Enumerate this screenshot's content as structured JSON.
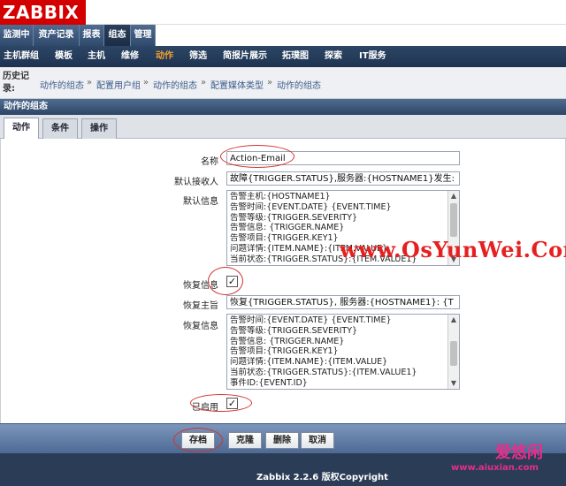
{
  "logo": "ZABBIX",
  "main_menu": [
    "监测中",
    "资产记录",
    "报表",
    "组态",
    "管理"
  ],
  "sub_menu": [
    "主机群组",
    "模板",
    "主机",
    "维修",
    "动作",
    "筛选",
    "简报片展示",
    "拓璞图",
    "探索",
    "IT服务"
  ],
  "history": {
    "label": "历史记录:",
    "crumbs": [
      "动作的组态",
      "配置用户组",
      "动作的组态",
      "配置媒体类型",
      "动作的组态"
    ],
    "sep": "»"
  },
  "section_title": "动作的组态",
  "tabs": [
    "动作",
    "条件",
    "操作"
  ],
  "form": {
    "name_label": "名称",
    "name_value": "Action-Email",
    "default_recipient_label": "默认接收人",
    "default_recipient_value": "故障{TRIGGER.STATUS},服务器:{HOSTNAME1}发生:",
    "default_message_label": "默认信息",
    "default_message_lines": [
      "告警主机:{HOSTNAME1}",
      "告警时间:{EVENT.DATE}  {EVENT.TIME}",
      "告警等级:{TRIGGER.SEVERITY}",
      "告警信息: {TRIGGER.NAME}",
      "告警项目:{TRIGGER.KEY1}",
      "问题详情:{ITEM.NAME}:{ITEM.VALUE}",
      "当前状态:{TRIGGER.STATUS}:{ITEM.VALUE1}"
    ],
    "recovery_label": "恢复信息",
    "recovery_checked": "✓",
    "recovery_subject_label": "恢复主旨",
    "recovery_subject_value": "恢复{TRIGGER.STATUS}, 服务器:{HOSTNAME1}: {T",
    "recovery_message_label": "恢复信息",
    "recovery_message_lines": [
      "告警时间:{EVENT.DATE}  {EVENT.TIME}",
      "告警等级:{TRIGGER.SEVERITY}",
      "告警信息: {TRIGGER.NAME}",
      "告警项目:{TRIGGER.KEY1}",
      "问题详情:{ITEM.NAME}:{ITEM.VALUE}",
      "当前状态:{TRIGGER.STATUS}:{ITEM.VALUE1}",
      "事件ID:{EVENT.ID}"
    ],
    "enabled_label": "已启用",
    "enabled_checked": "✓"
  },
  "buttons": {
    "save": "存档",
    "clone": "克隆",
    "delete": "删除",
    "cancel": "取消"
  },
  "footer": "Zabbix 2.2.6 版权Copyright",
  "watermarks": {
    "site1": "www.OsYunWei.Com",
    "site2_logo": "爱悠闲",
    "site2_url": "www.aiuxian.com"
  },
  "colors": {
    "logo_red": "#d40000",
    "nav_blue": "#2d4666",
    "active_orange": "#f4a32a",
    "annotation_red": "#d43030"
  }
}
